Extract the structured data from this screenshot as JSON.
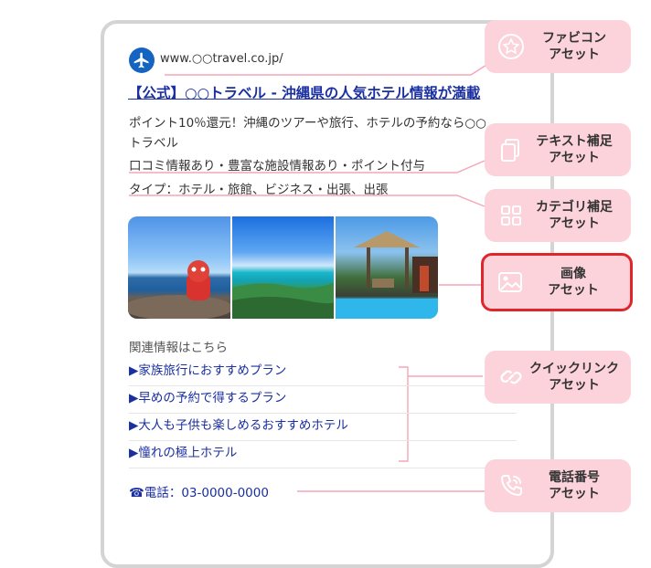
{
  "ad": {
    "url": "www.○○travel.co.jp/",
    "headline": "【公式】○○トラベル - 沖縄県の人気ホテル情報が満載",
    "description": "ポイント10％還元！沖縄のツアーや旅行、ホテルの予約なら○○トラベル",
    "snippet": "口コミ情報あり・豊富な施設情報あり・ポイント付与",
    "category": "タイプ：ホテル・旅館、ビジネス・出張、出張",
    "related_title": "関連情報はこちら",
    "quicklinks": [
      "▶家族旅行におすすめプラン",
      "▶早めの予約で得するプラン",
      "▶大人も子供も楽しめるおすすめホテル",
      "▶憧れの極上ホテル"
    ],
    "phone": "☎電話：03-0000-0000"
  },
  "callouts": [
    {
      "label": "ファビコン\nアセット",
      "icon": "star-circle-icon"
    },
    {
      "label": "テキスト補足\nアセット",
      "icon": "copy-icon"
    },
    {
      "label": "カテゴリ補足\nアセット",
      "icon": "grid-icon"
    },
    {
      "label": "画像\nアセット",
      "icon": "image-icon"
    },
    {
      "label": "クイックリンク\nアセット",
      "icon": "link-icon"
    },
    {
      "label": "電話番号\nアセット",
      "icon": "phone-icon"
    }
  ],
  "colors": {
    "accent_pink": "#fcd3db",
    "connector": "#f4a5b7",
    "highlight_red": "#e0262a",
    "link_blue": "#1a2fa0"
  }
}
